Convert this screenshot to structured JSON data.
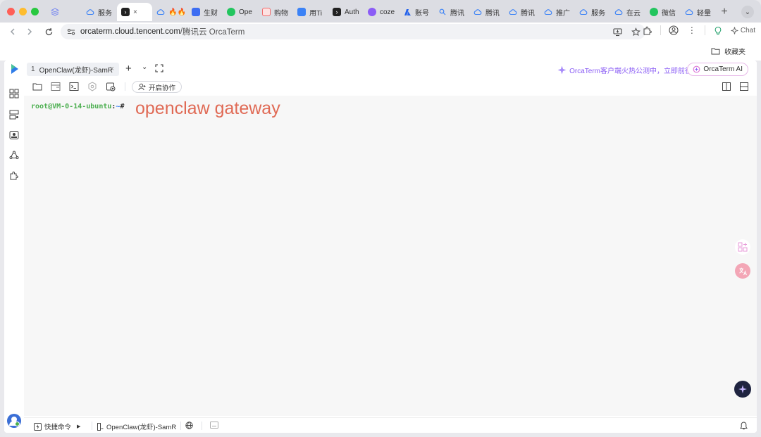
{
  "browser": {
    "tabs": [
      {
        "label": "",
        "icon": "stack-icon",
        "color": "#7c8cf0"
      },
      {
        "label": "服务",
        "icon": "cloud-icon",
        "color": "#3b82f6"
      },
      {
        "label": "",
        "icon": "terminal-icon",
        "color": "#222222",
        "active": true
      },
      {
        "label": "🔥🔥",
        "icon": "cloud-icon",
        "color": "#3b82f6"
      },
      {
        "label": "生财",
        "icon": "doc-icon",
        "color": "#3d6df2"
      },
      {
        "label": "Ope",
        "icon": "chat-bubble-icon",
        "color": "#22c55e"
      },
      {
        "label": "购物",
        "icon": "shop-icon",
        "color": "#f06a6a"
      },
      {
        "label": "用Ti",
        "icon": "diamond-icon",
        "color": "#3b82f6"
      },
      {
        "label": "Auth",
        "icon": "terminal-icon",
        "color": "#222222"
      },
      {
        "label": "coze",
        "icon": "coze-icon",
        "color": "#8b5cf6"
      },
      {
        "label": "账号",
        "icon": "azure-icon",
        "color": "#2563eb"
      },
      {
        "label": "腾讯",
        "icon": "search-icon",
        "color": "#3b82f6"
      },
      {
        "label": "腾讯",
        "icon": "cloud-icon",
        "color": "#3b82f6"
      },
      {
        "label": "腾讯",
        "icon": "cloud-icon",
        "color": "#3b82f6"
      },
      {
        "label": "推广",
        "icon": "cloud-icon",
        "color": "#3b82f6"
      },
      {
        "label": "服务",
        "icon": "cloud-icon",
        "color": "#3b82f6"
      },
      {
        "label": "在云",
        "icon": "cloud-icon",
        "color": "#3b82f6"
      },
      {
        "label": "微信",
        "icon": "chat-bubble-icon",
        "color": "#22c55e"
      },
      {
        "label": "轻量",
        "icon": "cloud-icon",
        "color": "#3b82f6"
      }
    ],
    "url_host": "orcaterm.cloud.tencent.com",
    "url_sep": " / ",
    "url_title": "腾讯云 OrcaTerm",
    "chat_label": "Chat",
    "bookmark_folder": "收藏夹"
  },
  "app": {
    "session_tab": {
      "num": "1",
      "label": "OpenClaw(龙虾)-SamR"
    },
    "promo_text": "OrcaTerm客户端火热公测中，立即前往",
    "ai_button": "OrcaTerm AI",
    "collab_button": "开启协作",
    "terminal": {
      "user_host": "root@VM-0-14-ubuntu",
      "colon": ":",
      "path": "~",
      "hash": "#",
      "command": "openclaw gateway"
    },
    "status": {
      "quick_cmd": "快捷命令",
      "server": "OpenClaw(龙虾)-SamR"
    }
  }
}
